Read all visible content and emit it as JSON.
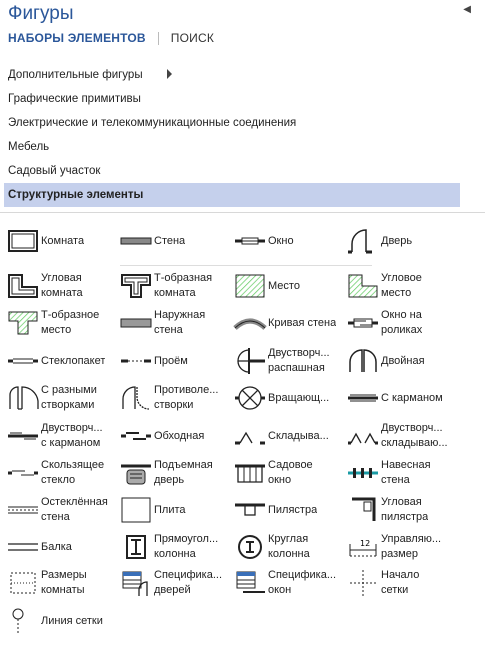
{
  "pane": {
    "title": "Фигуры",
    "collapse_icon": "triangle-left-icon"
  },
  "tabs": {
    "sets_label": "НАБОРЫ ЭЛЕМЕНТОВ",
    "search_label": "ПОИСК"
  },
  "stencil_sets": [
    {
      "label": "Дополнительные фигуры",
      "has_submenu": true
    },
    {
      "label": "Графические примитивы"
    },
    {
      "label": "Электрические и телекоммуникационные соединения"
    },
    {
      "label": "Мебель"
    },
    {
      "label": "Садовый участок"
    },
    {
      "label": "Структурные элементы",
      "selected": true
    }
  ],
  "shapes": [
    {
      "label": "Комната",
      "icon": "room-icon"
    },
    {
      "label": "Стена",
      "icon": "wall-icon"
    },
    {
      "label": "Окно",
      "icon": "window-icon"
    },
    {
      "label": "Дверь",
      "icon": "door-icon"
    },
    {
      "label": "Угловая\nкомната",
      "icon": "l-room-icon"
    },
    {
      "label": "Т-образная\nкомната",
      "icon": "t-room-icon"
    },
    {
      "label": "Место",
      "icon": "space-icon"
    },
    {
      "label": "Угловое\nместо",
      "icon": "l-space-icon"
    },
    {
      "label": "Т-образное\nместо",
      "icon": "t-space-icon"
    },
    {
      "label": "Наружная\nстена",
      "icon": "external-wall-icon"
    },
    {
      "label": "Кривая стена",
      "icon": "curved-wall-icon"
    },
    {
      "label": "Окно на\nроликах",
      "icon": "sliding-window-icon"
    },
    {
      "label": "Стеклопакет",
      "icon": "glazing-icon"
    },
    {
      "label": "Проём",
      "icon": "opening-icon"
    },
    {
      "label": "Двустворч...\nраспашная",
      "icon": "double-hung-door-icon"
    },
    {
      "label": "Двойная",
      "icon": "double-door-icon"
    },
    {
      "label": "С разными\nстворками",
      "icon": "uneven-door-icon"
    },
    {
      "label": "Противоле...\nстворки",
      "icon": "opposing-door-icon"
    },
    {
      "label": "Вращающ...",
      "icon": "revolving-door-icon"
    },
    {
      "label": "С карманом",
      "icon": "pocket-door-icon"
    },
    {
      "label": "Двустворч...\nс карманом",
      "icon": "double-pocket-icon"
    },
    {
      "label": "Обходная",
      "icon": "bypass-door-icon"
    },
    {
      "label": "Складыва...",
      "icon": "bifold-door-icon"
    },
    {
      "label": "Двустворч...\nскладываю...",
      "icon": "double-bifold-icon"
    },
    {
      "label": "Скользящее\nстекло",
      "icon": "sliding-glass-icon"
    },
    {
      "label": "Подъемная\nдверь",
      "icon": "overhead-door-icon"
    },
    {
      "label": "Садовое\nокно",
      "icon": "bay-window-icon"
    },
    {
      "label": "Навесная\nстена",
      "icon": "curtain-wall-icon"
    },
    {
      "label": "Остеклённая\nстена",
      "icon": "glass-wall-icon"
    },
    {
      "label": "Плита",
      "icon": "slab-icon"
    },
    {
      "label": "Пилястра",
      "icon": "pilaster-icon"
    },
    {
      "label": "Угловая\nпилястра",
      "icon": "corner-pilaster-icon"
    },
    {
      "label": "Балка",
      "icon": "beam-icon"
    },
    {
      "label": "Прямоугол...\nколонна",
      "icon": "rect-column-icon"
    },
    {
      "label": "Круглая\nколонна",
      "icon": "round-column-icon"
    },
    {
      "label": "Управляю...\nразмер",
      "icon": "controller-dimension-icon"
    },
    {
      "label": "Размеры\nкомнаты",
      "icon": "room-dimension-icon"
    },
    {
      "label": "Специфика...\nдверей",
      "icon": "door-schedule-icon"
    },
    {
      "label": "Специфика...\nокон",
      "icon": "window-schedule-icon"
    },
    {
      "label": "Начало\nсетки",
      "icon": "grid-origin-icon"
    },
    {
      "label": "Линия сетки",
      "icon": "grid-line-icon"
    }
  ]
}
